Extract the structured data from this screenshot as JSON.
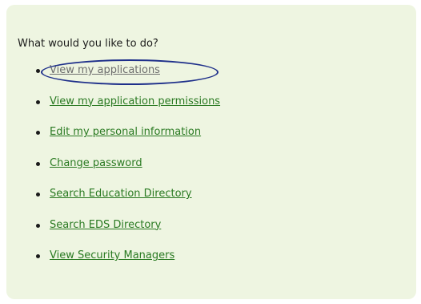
{
  "prompt": "What would you like to do?",
  "menu": {
    "items": [
      {
        "label": "View my applications"
      },
      {
        "label": "View my application permissions"
      },
      {
        "label": "Edit my personal information"
      },
      {
        "label": "Change password"
      },
      {
        "label": "Search Education Directory"
      },
      {
        "label": "Search EDS Directory"
      },
      {
        "label": "View Security Managers"
      }
    ]
  },
  "colors": {
    "panel_background": "#eef5e1",
    "link": "#2a7a22",
    "visited_link": "#6d6d6d",
    "highlight_ring": "#1e2f8a"
  }
}
